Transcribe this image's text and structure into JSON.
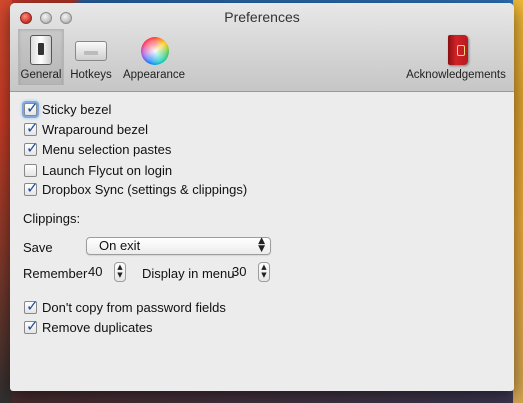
{
  "window": {
    "title": "Preferences"
  },
  "toolbar": {
    "tabs": [
      {
        "label": "General",
        "icon": "toggle-switch-icon"
      },
      {
        "label": "Hotkeys",
        "icon": "keyboard-icon"
      },
      {
        "label": "Appearance",
        "icon": "color-wheel-icon"
      },
      {
        "label": "Acknowledgements",
        "icon": "red-book-icon"
      }
    ],
    "selected": "General"
  },
  "options": [
    {
      "label": "Sticky bezel",
      "checked": true
    },
    {
      "label": "Wraparound bezel",
      "checked": true
    },
    {
      "label": "Menu selection pastes",
      "checked": true
    },
    {
      "label": "Launch Flycut on login",
      "checked": false
    },
    {
      "label": "Dropbox Sync (settings & clippings)",
      "checked": true
    }
  ],
  "clippings": {
    "heading": "Clippings:",
    "save_label": "Save",
    "save_value": "On exit",
    "remember_label": "Remember",
    "remember_value": "40",
    "display_label": "Display in menu",
    "display_value": "30"
  },
  "bottom_options": [
    {
      "label": "Don't copy from password fields",
      "checked": true
    },
    {
      "label": "Remove duplicates",
      "checked": true
    }
  ],
  "colors": {
    "close": "#d23b2f",
    "checkmark": "#1c4f9a",
    "window_bg": "#ececec"
  }
}
